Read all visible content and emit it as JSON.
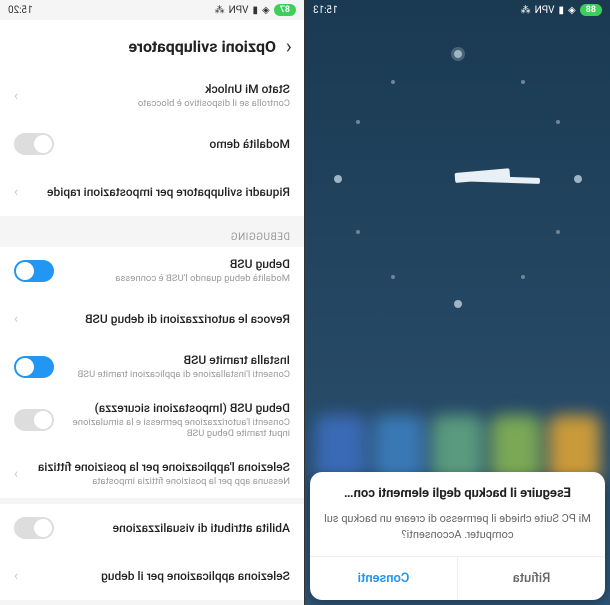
{
  "left": {
    "status": {
      "time": "15:13",
      "battery": "88"
    },
    "dialog": {
      "title": "Eseguire il backup degli elementi con…",
      "body": "Mi PC Suite chiede il permesso di creare un backup sul computer. Acconsenti?",
      "deny": "Rifiuta",
      "allow": "Consenti"
    }
  },
  "right": {
    "status": {
      "time": "15:20",
      "battery": "87"
    },
    "header": {
      "title": "Opzioni sviluppatore"
    },
    "section_debug": "DEBUGGING",
    "rows": {
      "mi_unlock": {
        "label": "Stato Mi Unlock",
        "sub": "Controlla se il dispositivo è bloccato"
      },
      "demo": {
        "label": "Modalità demo"
      },
      "quick_tiles": {
        "label": "Riquadri sviluppatore per impostazioni rapide"
      },
      "usb_debug": {
        "label": "Debug USB",
        "sub": "Modalità debug quando l'USB è connessa"
      },
      "revoke": {
        "label": "Revoca le autorizzazioni di debug USB"
      },
      "install_usb": {
        "label": "Installa tramite USB",
        "sub": "Consenti l'installazione di applicazioni tramite USB"
      },
      "usb_sec": {
        "label": "Debug USB (Impostazioni sicurezza)",
        "sub": "Consenti l'autorizzazione permessi e la simulazione input tramite Debug USB"
      },
      "mock_loc": {
        "label": "Seleziona l'applicazione per la posizione fittizia",
        "sub": "Nessuna app per la posizione fittizia impostata"
      },
      "view_attr": {
        "label": "Abilita attributi di visualizzazione"
      },
      "select_debug_app": {
        "label": "Seleziona applicazione per il debug"
      }
    }
  }
}
